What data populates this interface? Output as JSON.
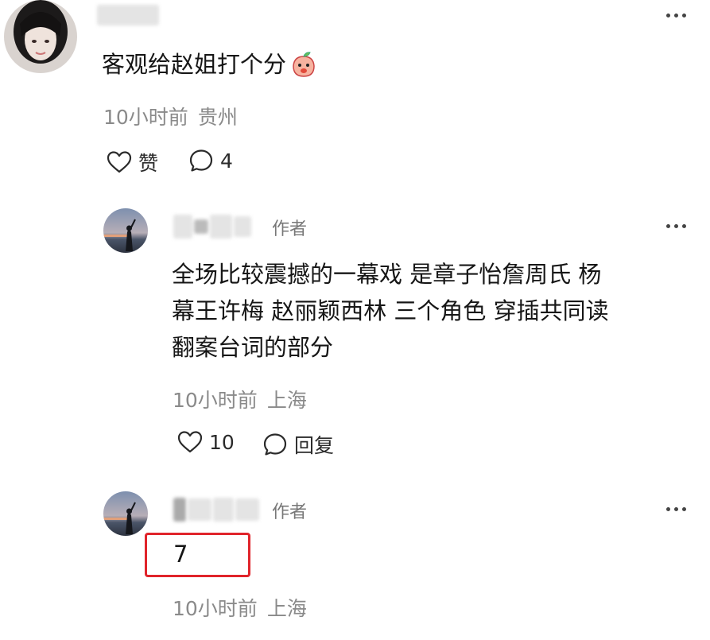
{
  "comment": {
    "text": "客观给赵姐打个分",
    "emoji_icon": "peach-face-emoji",
    "time": "10小时前",
    "location": "贵州",
    "like_label": "赞",
    "reply_count": "4"
  },
  "reply1": {
    "author_tag": "作者",
    "text_lines": [
      "全场比较震撼的一幕戏 是章子怡詹周氏 杨",
      "幕王许梅 赵丽颖西林 三个角色 穿插共同读",
      "翻案台词的部分"
    ],
    "time": "10小时前",
    "location": "上海",
    "like_count": "10",
    "reply_label": "回复"
  },
  "reply2": {
    "author_tag": "作者",
    "text": "7",
    "time": "10小时前",
    "location": "上海"
  },
  "colors": {
    "highlight": "#e0242b",
    "meta": "#8a8a8a",
    "text": "#161616"
  }
}
